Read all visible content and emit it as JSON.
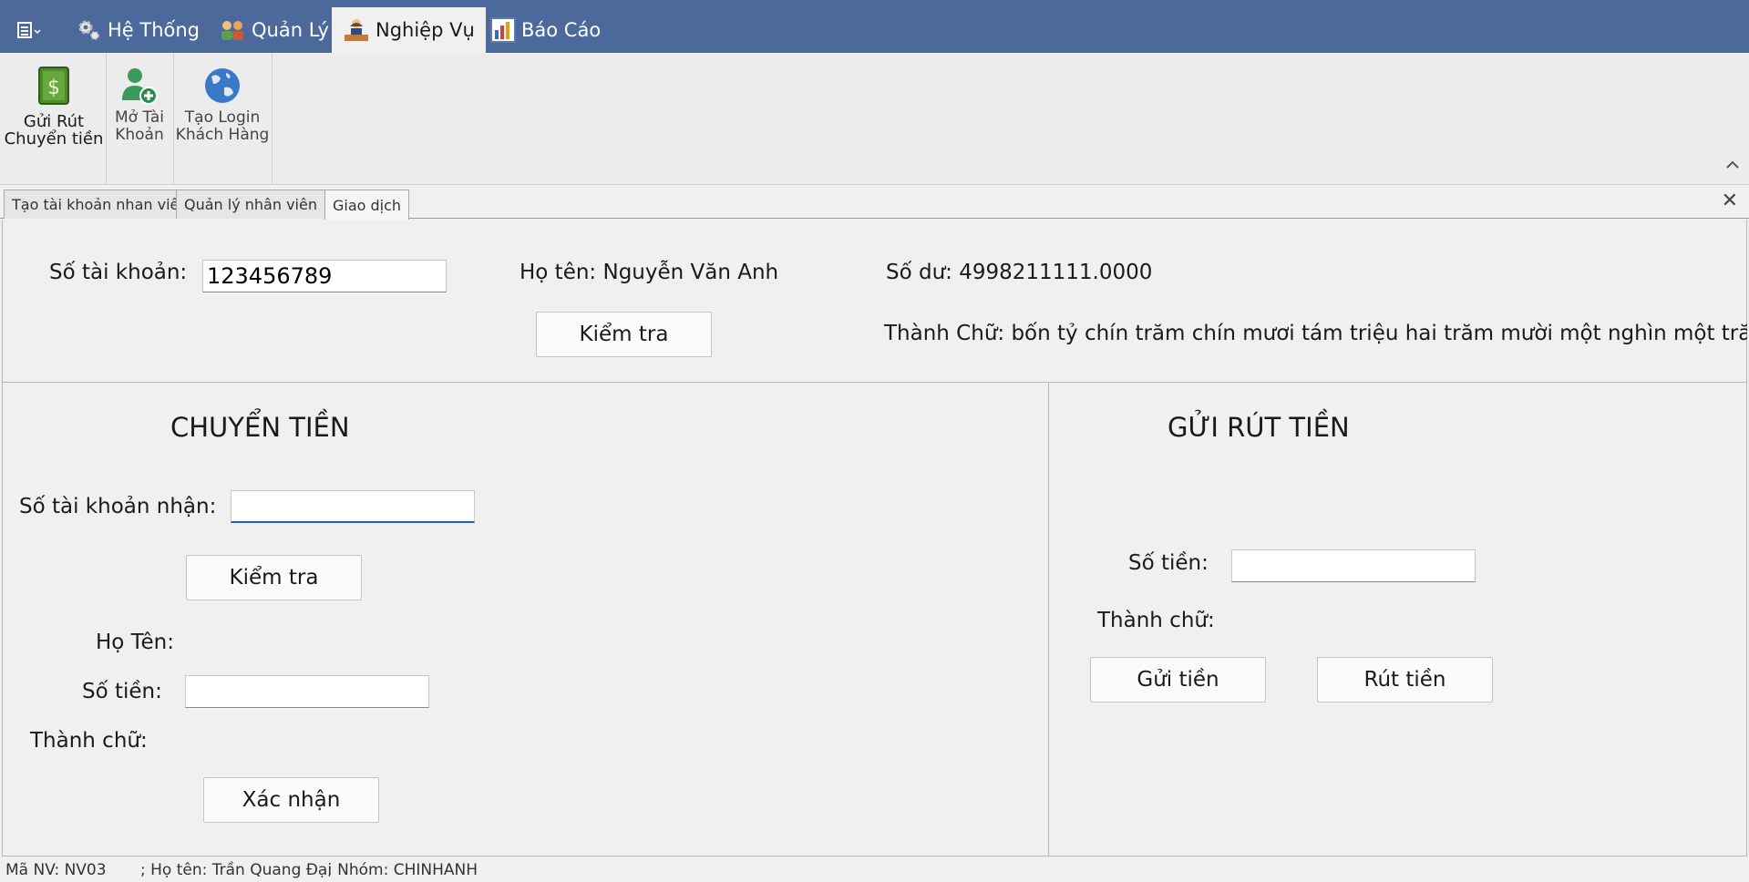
{
  "ribbon_tabs": [
    {
      "label": "Hệ Thống",
      "icon": "gears-icon"
    },
    {
      "label": "Quản Lý",
      "icon": "people-icon"
    },
    {
      "label": "Nghiệp Vụ",
      "icon": "worker-desk-icon"
    },
    {
      "label": "Báo Cáo",
      "icon": "report-chart-icon"
    }
  ],
  "ribbon_buttons": [
    {
      "line1": "Gửi Rút",
      "line2": "Chuyển tiền",
      "icon": "money-book-icon"
    },
    {
      "line1": "Mở Tài",
      "line2": "Khoản",
      "icon": "add-user-icon"
    },
    {
      "line1": "Tạo Login",
      "line2": "Khách Hàng",
      "icon": "globe-icon"
    }
  ],
  "doc_tabs": [
    "Tạo tài khoản nhan viên",
    "Quản lý nhân viên",
    "Giao dịch"
  ],
  "account": {
    "account_label": "Số tài khoản:",
    "account_value": "123456789",
    "name_text": "Họ tên: Nguyễn Văn Anh",
    "balance_text": "Số dư: 4998211111.0000",
    "check_button": "Kiểm tra",
    "words_text": "Thành Chữ: bốn tỷ chín trăm chín mươi tám triệu hai trăm mười một nghìn một trăm mười một"
  },
  "transfer": {
    "heading": "CHUYỂN TIỀN",
    "receiver_label": "Số tài khoản nhận:",
    "receiver_value": "",
    "check_button": "Kiểm tra",
    "name_label": "Họ Tên:",
    "amount_label": "Số tiền:",
    "amount_value": "",
    "words_label": "Thành chữ:",
    "confirm_button": "Xác nhận"
  },
  "deposit": {
    "heading": "GỬI RÚT TIỀN",
    "amount_label": "Số tiền:",
    "amount_value": "",
    "words_label": "Thành chữ:",
    "deposit_button": "Gửi tiền",
    "withdraw_button": "Rút tiền"
  },
  "status": {
    "employee_id": "Mã NV: NV03",
    "employee_name": "; Họ tên: Trần Quang Đại",
    "group": "; Nhóm: CHINHANH"
  },
  "colors": {
    "tab_bar": "#4b6a9b",
    "focus_accent": "#1f5fbf"
  }
}
